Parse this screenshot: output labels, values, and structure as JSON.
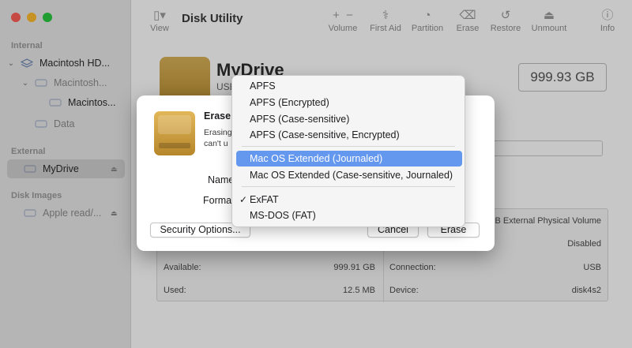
{
  "sidebar": {
    "sections": {
      "internal": "Internal",
      "external": "External",
      "images": "Disk Images"
    },
    "items": {
      "macintosh_hd": "Macintosh HD...",
      "macintosh_sub": "Macintosh...",
      "macintosh_snapshot": "Macintos...",
      "data": "Data",
      "mydrive": "MyDrive",
      "apple_read": "Apple read/..."
    }
  },
  "toolbar": {
    "title": "Disk Utility",
    "view": "View",
    "volume": "Volume",
    "first_aid": "First Aid",
    "partition": "Partition",
    "erase": "Erase",
    "restore": "Restore",
    "unmount": "Unmount",
    "info": "Info"
  },
  "drive": {
    "name": "MyDrive",
    "sub": "USB",
    "size": "999.93 GB"
  },
  "info": {
    "location_value": "B External Physical Volume",
    "owners_value": "Disabled",
    "available_label": "Available:",
    "available_value": "999.91 GB",
    "connection_label": "Connection:",
    "connection_value": "USB",
    "used_label": "Used:",
    "used_value": "12.5 MB",
    "device_label": "Device:",
    "device_value": "disk4s2"
  },
  "sheet": {
    "title": "Erase",
    "desc1": "Erasing",
    "desc2": "can't u",
    "name_label": "Name",
    "format_label": "Forma",
    "security_button": "Security Options...",
    "cancel_button": "Cancel",
    "erase_button": "Erase"
  },
  "menu": {
    "items": [
      {
        "label": "APFS"
      },
      {
        "label": "APFS (Encrypted)"
      },
      {
        "label": "APFS (Case-sensitive)"
      },
      {
        "label": "APFS (Case-sensitive, Encrypted)"
      },
      {
        "label": "Mac OS Extended (Journaled)"
      },
      {
        "label": "Mac OS Extended (Case-sensitive, Journaled)"
      },
      {
        "label": "ExFAT",
        "check": "✓"
      },
      {
        "label": "MS-DOS (FAT)"
      }
    ],
    "highlighted_index": 4,
    "highlight_color": "#6497ee"
  },
  "colors": {
    "traffic_red": "#fe5f57",
    "traffic_yellow": "#febc2e",
    "traffic_green": "#28c840",
    "drive_gold": "#c99a3c"
  }
}
